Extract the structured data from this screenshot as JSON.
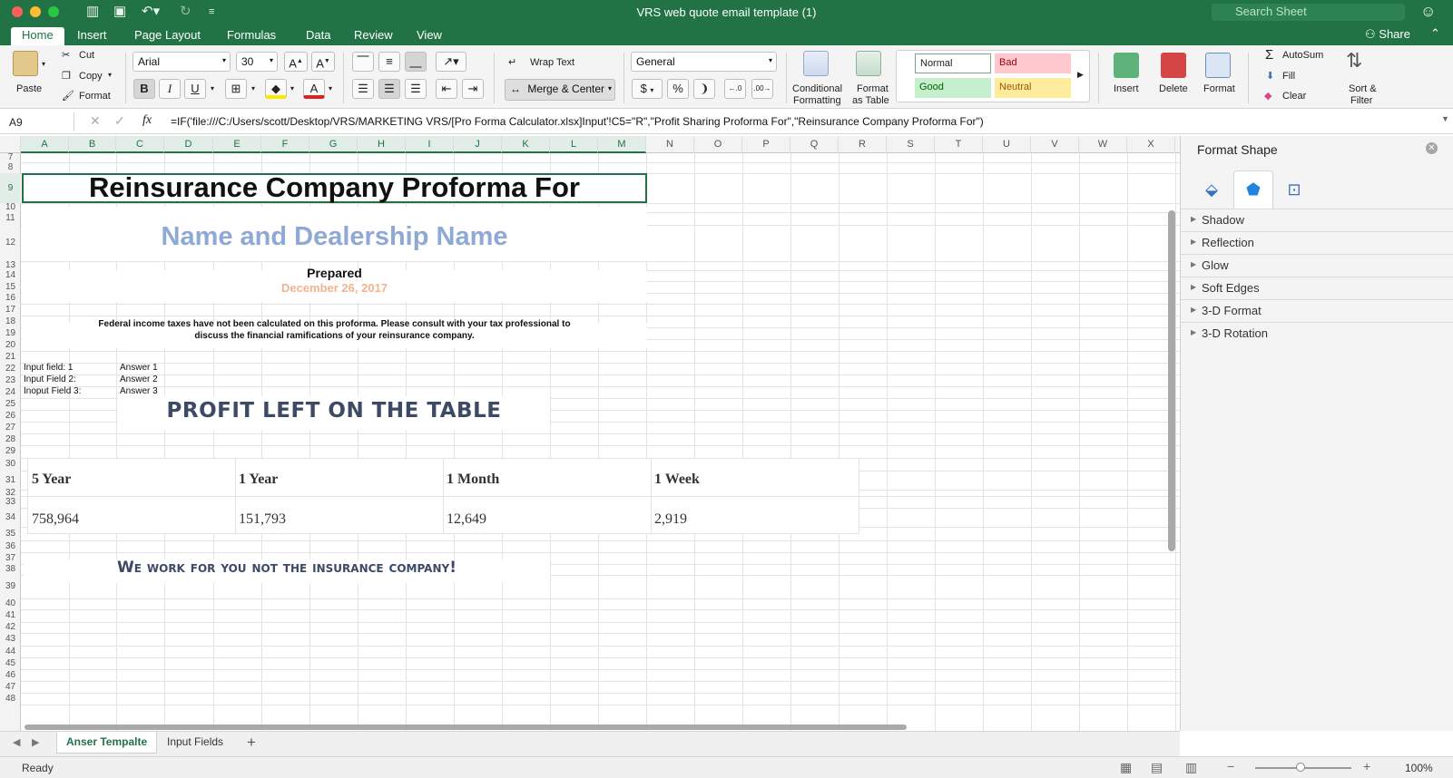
{
  "window": {
    "title": "VRS web quote email template (1)",
    "search_placeholder": "Search Sheet"
  },
  "tabs": [
    {
      "label": "Home",
      "active": true
    },
    {
      "label": "Insert"
    },
    {
      "label": "Page Layout"
    },
    {
      "label": "Formulas"
    },
    {
      "label": "Data"
    },
    {
      "label": "Review"
    },
    {
      "label": "View"
    }
  ],
  "share_label": "Share",
  "ribbon": {
    "paste": "Paste",
    "cut": "Cut",
    "copy": "Copy",
    "format": "Format",
    "font_name": "Arial",
    "font_size": "30",
    "bold": "B",
    "italic": "I",
    "underline": "U",
    "wrap_text": "Wrap Text",
    "merge_center": "Merge & Center",
    "number_format": "General",
    "currency": "$",
    "percent": "%",
    "conditional_formatting": [
      "Conditional",
      "Formatting"
    ],
    "format_as_table": [
      "Format",
      "as Table"
    ],
    "styles": {
      "normal": "Normal",
      "bad": "Bad",
      "good": "Good",
      "neutral": "Neutral"
    },
    "insert": "Insert",
    "delete": "Delete",
    "format_cells": "Format",
    "autosum": "AutoSum",
    "fill": "Fill",
    "clear": "Clear",
    "sort_filter": [
      "Sort &",
      "Filter"
    ]
  },
  "formula_bar": {
    "name_box": "A9",
    "fx": "fx",
    "formula": "=IF('file:///C:/Users/scott/Desktop/VRS/MARKETING VRS/[Pro Forma Calculator.xlsx]Input'!C5=\"R\",\"Profit Sharing Proforma For\",\"Reinsurance Company Proforma For\")"
  },
  "columns": [
    "A",
    "B",
    "C",
    "D",
    "E",
    "F",
    "G",
    "H",
    "I",
    "J",
    "K",
    "L",
    "M",
    "N",
    "O",
    "P",
    "Q",
    "R",
    "S",
    "T",
    "U",
    "V",
    "W",
    "X"
  ],
  "rows": [
    "7",
    "8",
    "9",
    "10",
    "11",
    "12",
    "13",
    "14",
    "15",
    "16",
    "17",
    "18",
    "19",
    "20",
    "21",
    "22",
    "23",
    "24",
    "25",
    "26",
    "27",
    "28",
    "29",
    "30",
    "31",
    "32",
    "33",
    "34",
    "35",
    "36",
    "37",
    "38",
    "39",
    "40",
    "41",
    "42",
    "43",
    "44",
    "45",
    "46",
    "47",
    "48"
  ],
  "sheet": {
    "title": "Reinsurance Company Proforma For",
    "dealer": "Name and Dealership Name",
    "prepared": "Prepared",
    "date": "December 26, 2017",
    "tax_note_1": "Federal income taxes have not been calculated on this proforma.  Please consult with your tax professional to",
    "tax_note_2": "discuss the financial ramifications of your reinsurance company.",
    "inputs": [
      {
        "label": "Input field: 1",
        "answer": "Answer  1"
      },
      {
        "label": "Input Field 2:",
        "answer": "Answer 2"
      },
      {
        "label": "Inoput Field 3:",
        "answer": "Answer 3"
      }
    ],
    "profit_heading": "PROFIT LEFT ON THE TABLE",
    "profit_table": {
      "headers": [
        "5 Year",
        "1 Year",
        "1 Month",
        "1 Week"
      ],
      "values": [
        "758,964",
        "151,793",
        "12,649",
        "2,919"
      ]
    },
    "slogan": "We work for you not the insurance company!"
  },
  "format_pane": {
    "title": "Format Shape",
    "sections": [
      "Shadow",
      "Reflection",
      "Glow",
      "Soft Edges",
      "3-D Format",
      "3-D Rotation"
    ]
  },
  "sheet_tabs": [
    "Anser Tempalte",
    "Input Fields"
  ],
  "status": {
    "ready": "Ready",
    "zoom": "100%"
  }
}
